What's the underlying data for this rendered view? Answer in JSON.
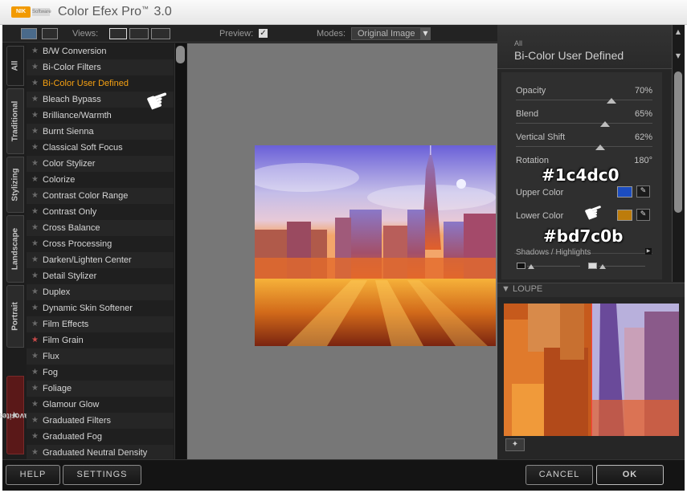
{
  "app": {
    "logo_text": "NIK",
    "logo_sub": "Software",
    "title": "Color Efex Pro",
    "title_tm": "™",
    "version": "3.0"
  },
  "toolbar": {
    "views_label": "Views:",
    "preview_label": "Preview:",
    "preview_checked": true,
    "modes_label": "Modes:",
    "modes_value": "Original Image"
  },
  "tabs": [
    {
      "label": "All",
      "selected": true
    },
    {
      "label": "Traditional"
    },
    {
      "label": "Stylizing"
    },
    {
      "label": "Landscape"
    },
    {
      "label": "Portrait"
    },
    {
      "label": "Favorites"
    }
  ],
  "filters": [
    {
      "label": "B/W Conversion"
    },
    {
      "label": "Bi-Color Filters"
    },
    {
      "label": "Bi-Color User Defined",
      "active": true
    },
    {
      "label": "Bleach Bypass"
    },
    {
      "label": "Brilliance/Warmth"
    },
    {
      "label": "Burnt Sienna"
    },
    {
      "label": "Classical Soft Focus"
    },
    {
      "label": "Color Stylizer"
    },
    {
      "label": "Colorize"
    },
    {
      "label": "Contrast Color Range"
    },
    {
      "label": "Contrast Only"
    },
    {
      "label": "Cross Balance"
    },
    {
      "label": "Cross Processing"
    },
    {
      "label": "Darken/Lighten Center"
    },
    {
      "label": "Detail Stylizer"
    },
    {
      "label": "Duplex"
    },
    {
      "label": "Dynamic Skin Softener"
    },
    {
      "label": "Film Effects"
    },
    {
      "label": "Film Grain",
      "favorite": true
    },
    {
      "label": "Flux"
    },
    {
      "label": "Fog"
    },
    {
      "label": "Foliage"
    },
    {
      "label": "Glamour Glow"
    },
    {
      "label": "Graduated Filters"
    },
    {
      "label": "Graduated Fog"
    },
    {
      "label": "Graduated Neutral Density"
    }
  ],
  "panel": {
    "category": "All",
    "title": "Bi-Color User Defined",
    "params": [
      {
        "label": "Opacity",
        "value": "70%",
        "level": 0.7
      },
      {
        "label": "Blend",
        "value": "65%",
        "level": 0.65
      },
      {
        "label": "Vertical Shift",
        "value": "62%",
        "level": 0.62
      },
      {
        "label": "Rotation",
        "value": "180°"
      }
    ],
    "upper_color_label": "Upper Color",
    "upper_color": "#1c4dc0",
    "upper_hex_text": "#1c4dc0",
    "lower_color_label": "Lower Color",
    "lower_color": "#bd7c0b",
    "lower_hex_text": "#bd7c0b",
    "shadows_label": "Shadows / Highlights"
  },
  "loupe": {
    "label": "LOUPE"
  },
  "buttons": {
    "help": "HELP",
    "settings": "SETTINGS",
    "cancel": "CANCEL",
    "ok": "OK"
  },
  "colors": {
    "accent": "#f5a012",
    "favorite_star": "#c94a4a"
  }
}
